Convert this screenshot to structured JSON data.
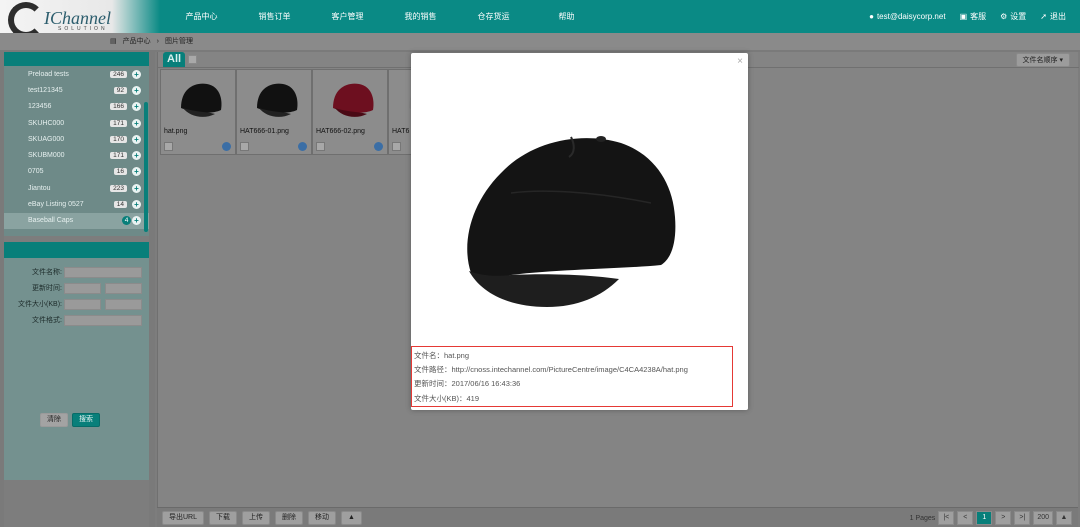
{
  "brand": {
    "name": "IChannel",
    "sub": "SOLUTION"
  },
  "nav": {
    "items": [
      "产品中心",
      "销售订单",
      "客户管理",
      "我的销售",
      "仓存货运",
      "帮助"
    ],
    "user_email": "test@daisycorp.net",
    "service_label": "客服",
    "settings_label": "设置",
    "logout_label": "退出"
  },
  "breadcrumb": {
    "home": "产品中心",
    "sep": "›",
    "current": "图片管理"
  },
  "sidebar": {
    "groups": [
      {
        "name": "Preload tests",
        "count": "246"
      },
      {
        "name": "test121345",
        "count": "92"
      },
      {
        "name": "123456",
        "count": "166"
      },
      {
        "name": "SKUHC000",
        "count": "171"
      },
      {
        "name": "SKUAG000",
        "count": "170"
      },
      {
        "name": "SKUBM000",
        "count": "171"
      },
      {
        "name": "0705",
        "count": "16"
      },
      {
        "name": "Jiantou",
        "count": "223"
      },
      {
        "name": "eBay Listing 0527",
        "count": "14"
      },
      {
        "name": "Baseball Caps",
        "count": "4"
      }
    ],
    "filter": {
      "file_name_label": "文件名称:",
      "update_time_label": "更新时间:",
      "file_size_label": "文件大小(KB):",
      "file_format_label": "文件格式:",
      "clear_label": "清除",
      "search_label": "搜索"
    }
  },
  "main": {
    "tab_all": "All",
    "sort_label": "文件名顺序 ▾",
    "thumbs": [
      {
        "name": "hat.png",
        "color": "#111111"
      },
      {
        "name": "HAT666-01.png",
        "color": "#111111"
      },
      {
        "name": "HAT666-02.png",
        "color": "#6d0f1f"
      },
      {
        "name": "HAT6",
        "color": "#888888"
      }
    ],
    "buttons": [
      "导出URL",
      "下载",
      "上传",
      "删除",
      "移动"
    ],
    "move_arrow": "▲",
    "pager": {
      "pages_text": "1 Pages",
      "first": "|<",
      "prev": "<",
      "current": "1",
      "next": ">",
      "last": ">|",
      "page_size": "200",
      "page_size_arrow": "▲"
    }
  },
  "modal": {
    "close": "×",
    "file_name": "文件名：hat.png",
    "file_path": "文件路径：http://cnoss.intechannel.com/PictureCentre/image/C4CA4238A/hat.png",
    "updated": "更新时间：2017/06/16 16:43:36",
    "file_size": "文件大小(KB)：419"
  }
}
